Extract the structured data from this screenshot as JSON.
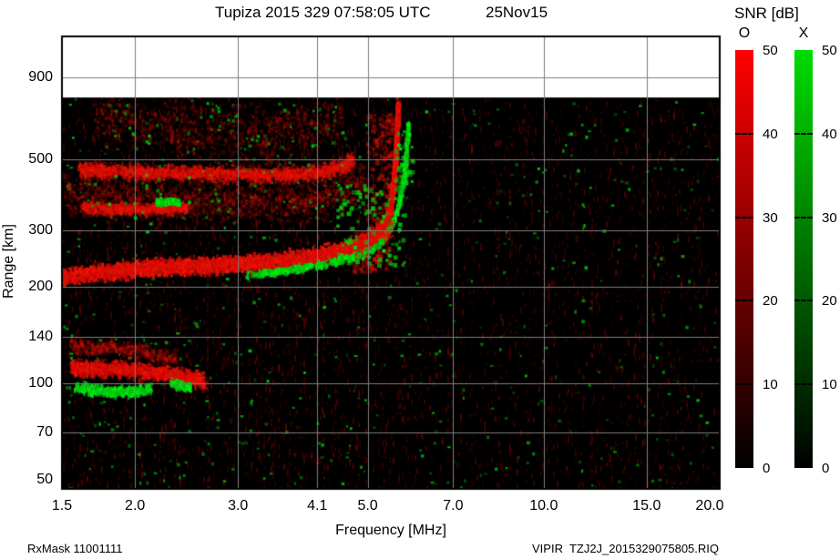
{
  "header": {
    "title": "Tupiza 2015 329 07:58:05 UTC",
    "date": "25Nov15"
  },
  "legend": {
    "title": "SNR [dB]"
  },
  "footer": {
    "left": "RxMask 11001111",
    "right": "VIPIR  TZJ2J_2015329075805.RIQ"
  },
  "chart_data": {
    "type": "heatmap",
    "title": "Tupiza 2015 329 07:58:05 UTC",
    "subtitle": "25Nov15",
    "xlabel": "Frequency [MHz]",
    "ylabel": "Range [km]",
    "x_scale": "log",
    "x_range": [
      1.5,
      20.0
    ],
    "x_ticks": [
      {
        "v": 1.5,
        "label": "1.5"
      },
      {
        "v": 2.0,
        "label": "2.0"
      },
      {
        "v": 3.0,
        "label": "3.0"
      },
      {
        "v": 4.1,
        "label": "4.1"
      },
      {
        "v": 5.0,
        "label": "5.0"
      },
      {
        "v": 7.0,
        "label": "7.0"
      },
      {
        "v": 10.0,
        "label": "10.0"
      },
      {
        "v": 15.0,
        "label": "15.0"
      },
      {
        "v": 20.0,
        "label": "20.0"
      }
    ],
    "y_scale": "log",
    "y_range": [
      46.8,
      1210
    ],
    "y_ticks": [
      {
        "v": 900,
        "label": "900",
        "grid": true
      },
      {
        "v": 500,
        "label": "500",
        "grid": true
      },
      {
        "v": 300,
        "label": "300",
        "grid": true
      },
      {
        "v": 200,
        "label": "200",
        "grid": true
      },
      {
        "v": 140,
        "label": "140",
        "grid": true
      },
      {
        "v": 100,
        "label": "100",
        "grid": true
      },
      {
        "v": 70,
        "label": "70",
        "grid": true
      },
      {
        "v": 50,
        "label": "50",
        "grid": false
      }
    ],
    "grid": true,
    "data_top_km": 780,
    "legend_title": "SNR [dB]",
    "colorbars": [
      {
        "label": "O",
        "mode": "ordinary",
        "color_top": "#ff0000",
        "color_bottom": "#000000",
        "min": 0,
        "max": 50,
        "ticks": [
          50,
          40,
          30,
          20,
          10,
          0
        ]
      },
      {
        "label": "X",
        "mode": "extraordinary",
        "color_top": "#00dc00",
        "color_bottom": "#000000",
        "min": 0,
        "max": 50,
        "ticks": [
          50,
          40,
          30,
          20,
          10,
          0
        ]
      }
    ],
    "traces": [
      {
        "name": "upper-spread-echo",
        "color": "red",
        "width": 48,
        "intensity": 6,
        "alpha": [
          0.07,
          0.32
        ],
        "gap": 0.15,
        "points": [
          [
            1.7,
            690
          ],
          [
            2.3,
            630
          ],
          [
            3.1,
            600
          ],
          [
            3.9,
            625
          ],
          [
            4.5,
            690
          ]
        ]
      },
      {
        "name": "mid-diffuse-echo",
        "color": "red",
        "width": 36,
        "intensity": 7,
        "alpha": [
          0.08,
          0.33
        ],
        "gap": 0.1,
        "points": [
          [
            1.5,
            395
          ],
          [
            2.2,
            378
          ],
          [
            3.1,
            368
          ],
          [
            3.9,
            376
          ],
          [
            4.5,
            405
          ],
          [
            4.95,
            450
          ]
        ]
      },
      {
        "name": "second-hop-450km",
        "color": "red",
        "width": 12,
        "intensity": 10,
        "alpha": [
          0.25,
          0.7
        ],
        "gap": 0.05,
        "points": [
          [
            1.6,
            468
          ],
          [
            2.1,
            460
          ],
          [
            2.9,
            455
          ],
          [
            3.6,
            452
          ],
          [
            4.1,
            460
          ],
          [
            4.5,
            480
          ],
          [
            4.7,
            505
          ]
        ]
      },
      {
        "name": "segment-355km",
        "color": "red",
        "width": 9,
        "intensity": 9,
        "alpha": [
          0.25,
          0.65
        ],
        "gap": 0.05,
        "points": [
          [
            1.62,
            356
          ],
          [
            2.0,
            353
          ],
          [
            2.45,
            356
          ]
        ]
      },
      {
        "name": "e-layer-diffuse",
        "color": "red",
        "width": 13,
        "intensity": 6,
        "alpha": [
          0.1,
          0.4
        ],
        "gap": 0.1,
        "points": [
          [
            1.55,
            132
          ],
          [
            1.95,
            128
          ],
          [
            2.35,
            121
          ]
        ]
      },
      {
        "name": "e-layer-echo",
        "color": "red",
        "width": 13,
        "intensity": 11,
        "alpha": [
          0.3,
          0.8
        ],
        "gap": 0.05,
        "points": [
          [
            1.55,
            113
          ],
          [
            1.85,
            112
          ],
          [
            2.15,
            109
          ],
          [
            2.45,
            106
          ],
          [
            2.62,
            103
          ]
        ]
      },
      {
        "name": "f2-o-trace",
        "color": "red",
        "width": 13,
        "intensity": 13,
        "alpha": [
          0.4,
          0.95
        ],
        "gap": 0.02,
        "points": [
          [
            1.5,
            218
          ],
          [
            1.9,
            228
          ],
          [
            2.3,
            233
          ],
          [
            2.8,
            236
          ],
          [
            3.4,
            241
          ],
          [
            4.0,
            250
          ],
          [
            4.5,
            263
          ],
          [
            4.9,
            278
          ],
          [
            5.15,
            295
          ],
          [
            5.35,
            320
          ],
          [
            5.45,
            360
          ],
          [
            5.52,
            430
          ],
          [
            5.56,
            520
          ],
          [
            5.58,
            600
          ],
          [
            5.6,
            690
          ],
          [
            5.61,
            740
          ]
        ]
      },
      {
        "name": "f2-x-trace",
        "color": "green",
        "width": 6,
        "intensity": 6,
        "alpha": [
          0.45,
          0.95
        ],
        "gap": 0.28,
        "points": [
          [
            3.1,
            220
          ],
          [
            3.7,
            228
          ],
          [
            4.2,
            238
          ],
          [
            4.7,
            250
          ],
          [
            5.05,
            264
          ],
          [
            5.3,
            285
          ],
          [
            5.5,
            318
          ],
          [
            5.65,
            372
          ],
          [
            5.75,
            452
          ],
          [
            5.81,
            550
          ],
          [
            5.85,
            655
          ]
        ]
      },
      {
        "name": "e-x-patch-1",
        "color": "green",
        "width": 8,
        "intensity": 9,
        "alpha": [
          0.5,
          0.95
        ],
        "gap": 0.05,
        "points": [
          [
            1.58,
            98
          ],
          [
            1.78,
            95
          ],
          [
            2.0,
            95
          ],
          [
            2.12,
            97
          ]
        ]
      },
      {
        "name": "e-x-patch-2",
        "color": "green",
        "width": 7,
        "intensity": 7,
        "alpha": [
          0.5,
          0.9
        ],
        "gap": 0.05,
        "points": [
          [
            2.3,
            101
          ],
          [
            2.48,
            98
          ]
        ]
      },
      {
        "name": "green-streak-372km",
        "color": "green",
        "width": 5,
        "intensity": 9,
        "alpha": [
          0.6,
          0.95
        ],
        "gap": 0.02,
        "points": [
          [
            2.17,
            372
          ],
          [
            2.38,
            372
          ]
        ]
      }
    ],
    "scatter_boxes": [
      {
        "name": "cusp-red-fuzz",
        "color": "red",
        "f": [
          4.95,
          5.5
        ],
        "r": [
          290,
          700
        ],
        "count": 300,
        "alpha": [
          0.15,
          0.5
        ],
        "size": [
          2,
          5
        ]
      },
      {
        "name": "pre-cusp-red-fuzz",
        "color": "red",
        "f": [
          4.7,
          5.45
        ],
        "r": [
          225,
          300
        ],
        "count": 160,
        "alpha": [
          0.2,
          0.55
        ],
        "size": [
          2,
          5
        ]
      },
      {
        "name": "cusp-green-speckle",
        "color": "green",
        "f": [
          4.4,
          5.75
        ],
        "r": [
          235,
          430
        ],
        "count": 110,
        "alpha": [
          0.4,
          0.9
        ],
        "size": [
          3,
          5
        ]
      },
      {
        "name": "high-green-speckle",
        "color": "green",
        "f": [
          5.55,
          5.95
        ],
        "r": [
          420,
          620
        ],
        "count": 40,
        "alpha": [
          0.4,
          0.9
        ],
        "size": [
          3,
          5
        ]
      },
      {
        "name": "hop-green-speckle",
        "color": "green",
        "f": [
          1.6,
          4.5
        ],
        "r": [
          330,
          520
        ],
        "count": 60,
        "alpha": [
          0.35,
          0.8
        ],
        "size": [
          2,
          4
        ]
      },
      {
        "name": "top-green-speckle",
        "color": "green",
        "f": [
          1.8,
          4.6
        ],
        "r": [
          540,
          760
        ],
        "count": 50,
        "alpha": [
          0.3,
          0.75
        ],
        "size": [
          2,
          4
        ]
      }
    ],
    "noise": {
      "red_streak_columns": true,
      "fine_red_dots": 3500,
      "green_dots": 520,
      "seed": 42
    }
  }
}
